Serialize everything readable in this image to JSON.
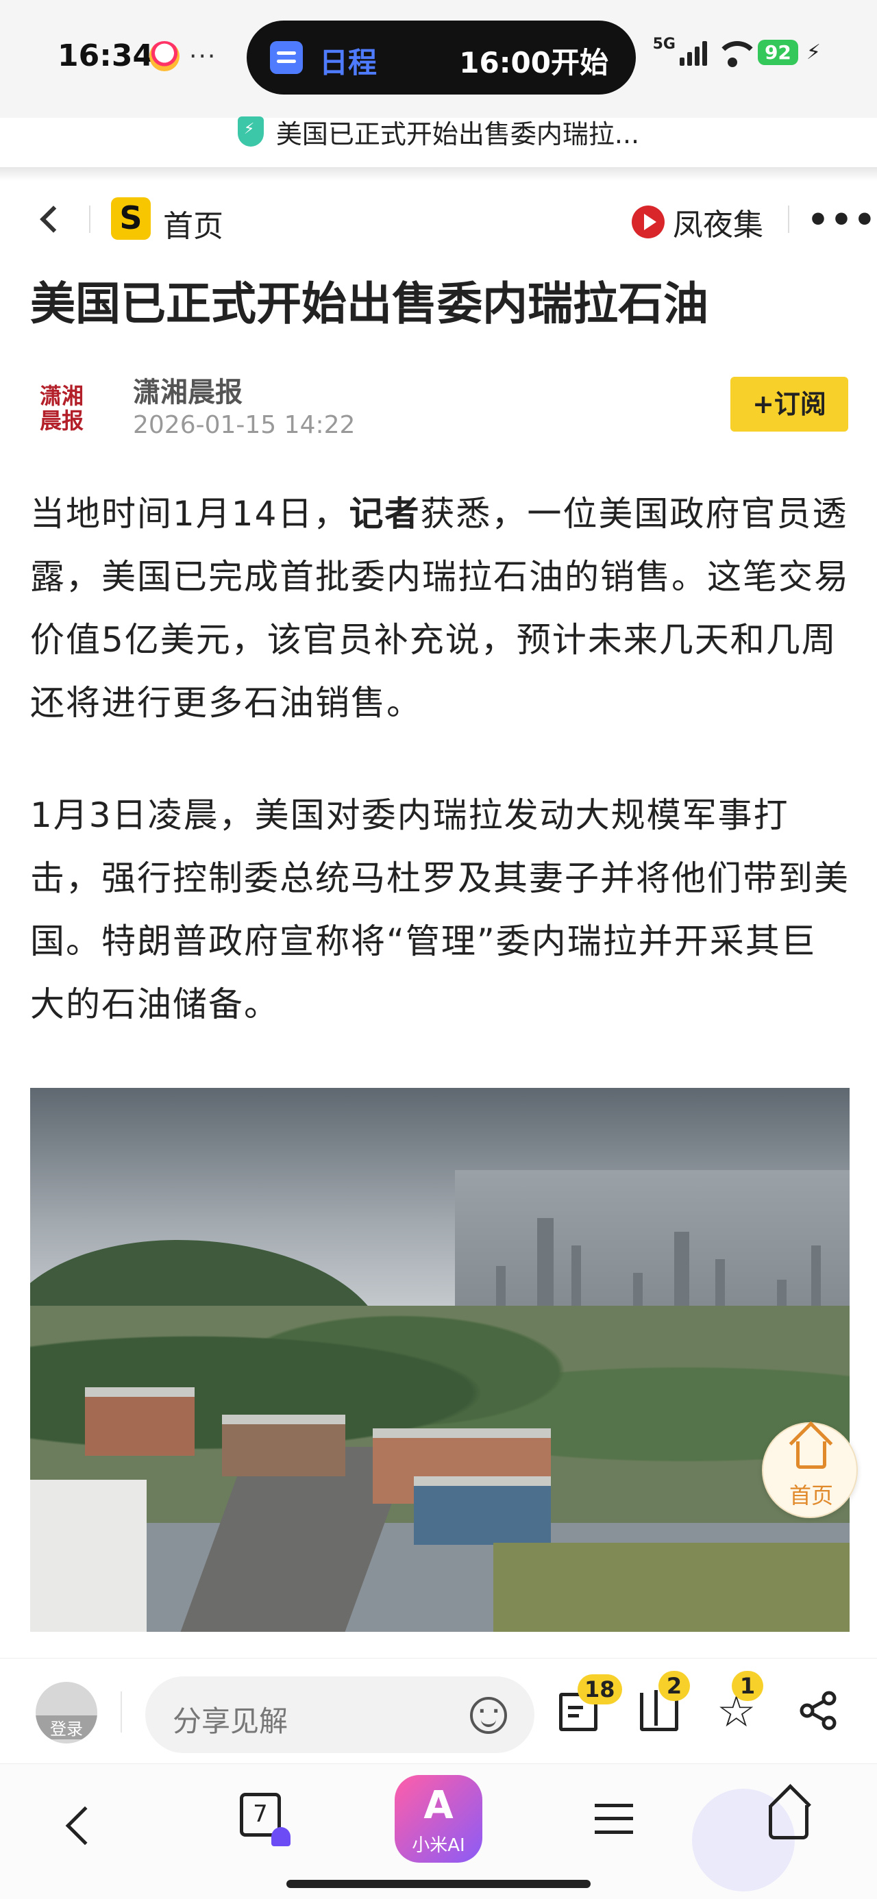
{
  "status_bar": {
    "time": "16:34",
    "island_label": "日程",
    "island_time": "16:00开始",
    "network": "5G",
    "battery": "92"
  },
  "url_bar": {
    "page_title": "美国已正式开始出售委内瑞拉..."
  },
  "nav": {
    "home_label": "首页",
    "logo_letter": "S",
    "channel_label": "凤夜集",
    "more_label": "•••"
  },
  "article": {
    "headline": "美国已正式开始出售委内瑞拉石油",
    "author": {
      "logo_text": "潇湘晨报",
      "name": "潇湘晨报",
      "date": "2026-01-15 14:22"
    },
    "subscribe_label": "+订阅",
    "paragraph1_pre": "当地时间1月14日，",
    "paragraph1_bold": "记者",
    "paragraph1_post": "获悉，一位美国政府官员透露，美国已完成首批委内瑞拉石油的销售。这笔交易价值5亿美元，该官员补充说，预计未来几天和几周还将进行更多石油销售。",
    "paragraph2": "1月3日凌晨，美国对委内瑞拉发动大规模军事打击，强行控制委总统马杜罗及其妻子并将他们带到美国。特朗普政府宣称将“管理”委内瑞拉并开采其巨大的石油储备。"
  },
  "float_home": {
    "label": "首页"
  },
  "comment_bar": {
    "avatar_label": "登录",
    "placeholder": "分享见解",
    "comment_count": "18",
    "like_count": "2",
    "favorite_count": "1"
  },
  "bottom_nav": {
    "tab_count": "7",
    "ai_label": "小米AI",
    "ai_glyph": "A"
  },
  "colors": {
    "accent_yellow": "#f7d02a",
    "island_blue": "#4f7cff",
    "battery_green": "#34c759",
    "float_orange": "#e08a2b"
  }
}
